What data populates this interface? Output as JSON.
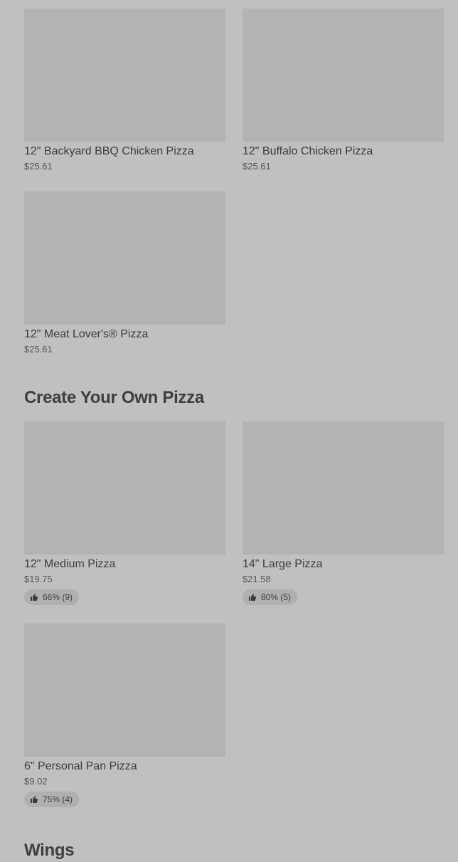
{
  "sections": [
    {
      "title": "",
      "items": [
        {
          "name": "12\" Backyard BBQ Chicken Pizza",
          "price": "$25.61"
        },
        {
          "name": "12\" Buffalo Chicken Pizza",
          "price": "$25.61"
        },
        {
          "name": "12\" Meat Lover's® Pizza",
          "price": "$25.61"
        }
      ]
    },
    {
      "title": "Create Your Own Pizza",
      "items": [
        {
          "name": "12\" Medium Pizza",
          "price": "$19.75",
          "rating": "66% (9)"
        },
        {
          "name": "14\" Large Pizza",
          "price": "$21.58",
          "rating": "80% (5)"
        },
        {
          "name": "6\" Personal Pan Pizza",
          "price": "$9.02",
          "rating": "75% (4)"
        }
      ]
    },
    {
      "title": "Wings",
      "items": []
    }
  ],
  "icons": {
    "rating": "thumbs-up-icon"
  },
  "colors": {
    "background": "#c0c0c0",
    "thumbnail": "#b3b3b3",
    "badge": "#b0b0b0"
  }
}
